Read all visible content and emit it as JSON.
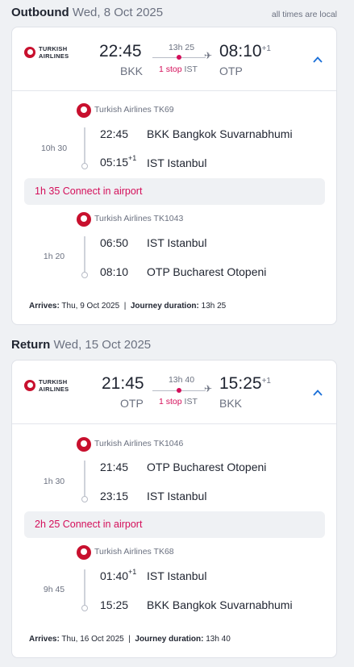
{
  "outbound": {
    "label": "Outbound",
    "date": "Wed, 8 Oct 2025",
    "tz_note": "all times are local",
    "airline": "TURKISH AIRLINES",
    "dep_time": "22:45",
    "dep_code": "BKK",
    "arr_time": "08:10",
    "arr_offset": "+1",
    "arr_code": "OTP",
    "duration": "13h 25",
    "stops_label": "1 stop",
    "stop_code": "IST",
    "legs": [
      {
        "carrier": "Turkish Airlines TK69",
        "duration": "10h 30",
        "dep_time": "22:45",
        "dep_offset": "",
        "dep_place": "BKK Bangkok Suvarnabhumi",
        "arr_time": "05:15",
        "arr_offset": "+1",
        "arr_place": "IST Istanbul"
      },
      {
        "carrier": "Turkish Airlines TK1043",
        "duration": "1h 20",
        "dep_time": "06:50",
        "dep_offset": "",
        "dep_place": "IST Istanbul",
        "arr_time": "08:10",
        "arr_offset": "",
        "arr_place": "OTP Bucharest Otopeni"
      }
    ],
    "connection": "1h 35   Connect in airport",
    "arrives_label": "Arrives:",
    "arrives_value": "Thu, 9 Oct 2025",
    "journey_label": "Journey duration:",
    "journey_value": "13h 25"
  },
  "return": {
    "label": "Return",
    "date": "Wed, 15 Oct 2025",
    "airline": "TURKISH AIRLINES",
    "dep_time": "21:45",
    "dep_code": "OTP",
    "arr_time": "15:25",
    "arr_offset": "+1",
    "arr_code": "BKK",
    "duration": "13h 40",
    "stops_label": "1 stop",
    "stop_code": "IST",
    "legs": [
      {
        "carrier": "Turkish Airlines TK1046",
        "duration": "1h 30",
        "dep_time": "21:45",
        "dep_offset": "",
        "dep_place": "OTP Bucharest Otopeni",
        "arr_time": "23:15",
        "arr_offset": "",
        "arr_place": "IST Istanbul"
      },
      {
        "carrier": "Turkish Airlines TK68",
        "duration": "9h 45",
        "dep_time": "01:40",
        "dep_offset": "+1",
        "dep_place": "IST Istanbul",
        "arr_time": "15:25",
        "arr_offset": "",
        "arr_place": "BKK Bangkok Suvarnabhumi"
      }
    ],
    "connection": "2h 25   Connect in airport",
    "arrives_label": "Arrives:",
    "arrives_value": "Thu, 16 Oct 2025",
    "journey_label": "Journey duration:",
    "journey_value": "13h 40"
  },
  "colors": {
    "accent": "#d40f5a",
    "brand": "#c8102e",
    "link": "#1a6fd8"
  },
  "icons": {
    "collapse": "chevron-up-icon",
    "plane": "plane-icon"
  }
}
